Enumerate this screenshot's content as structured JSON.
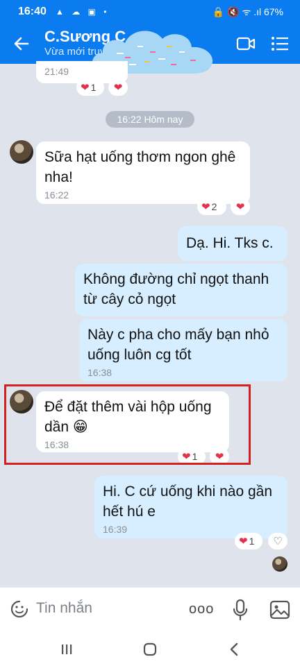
{
  "status_bar": {
    "time": "16:40",
    "icons": "▲ ☁ ▣ •",
    "right_icons": "🔒 🔇 ᯤ .ıl",
    "battery": "67%"
  },
  "header": {
    "contact_name": "C.Sương C",
    "status": "Vừa mới truy",
    "back_icon": "arrow-left-icon"
  },
  "messages": {
    "prev_time": "21:49",
    "prev_reaction_count": "1",
    "date_separator": "16:22 Hôm nay",
    "m1_text": "Sữa hạt uống thơm ngon ghê nha!",
    "m1_time": "16:22",
    "m1_reaction_count": "2",
    "m2_text": "Dạ. Hi. Tks c.",
    "m3_text": "Không đường chỉ ngọt thanh từ cây cỏ ngọt",
    "m4_text": "Này c pha cho mấy bạn nhỏ uống luôn cg tốt",
    "m4_time": "16:38",
    "m5_text": "Để đặt thêm vài hộp uống dần 😁",
    "m5_time": "16:38",
    "m5_reaction_count": "1",
    "m6_text": "Hi. C cứ uống khi nào gần hết hú e",
    "m6_time": "16:39",
    "m6_reaction_count": "1"
  },
  "input": {
    "placeholder": "Tin nhắn",
    "more_label": "ooo"
  },
  "colors": {
    "header_blue": "#0a7cf0",
    "highlight_red": "#d32020",
    "my_bubble": "#d6eeff"
  }
}
